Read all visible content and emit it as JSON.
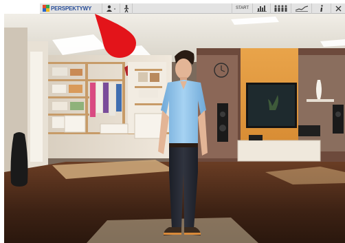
{
  "app": {
    "logo_text": "PERSPEKTYWY"
  },
  "toolbar": {
    "start_label": "START",
    "icons": [
      "avatar-icon",
      "walk-icon",
      "chart-icon",
      "people-icon",
      "trend-icon",
      "info-icon",
      "close-icon"
    ]
  },
  "colors": {
    "pointer": "#e3141a",
    "toolbar_bg": "#e3e3e3",
    "logo_text": "#2a4f9a",
    "shirt": "#8fc3ec"
  }
}
